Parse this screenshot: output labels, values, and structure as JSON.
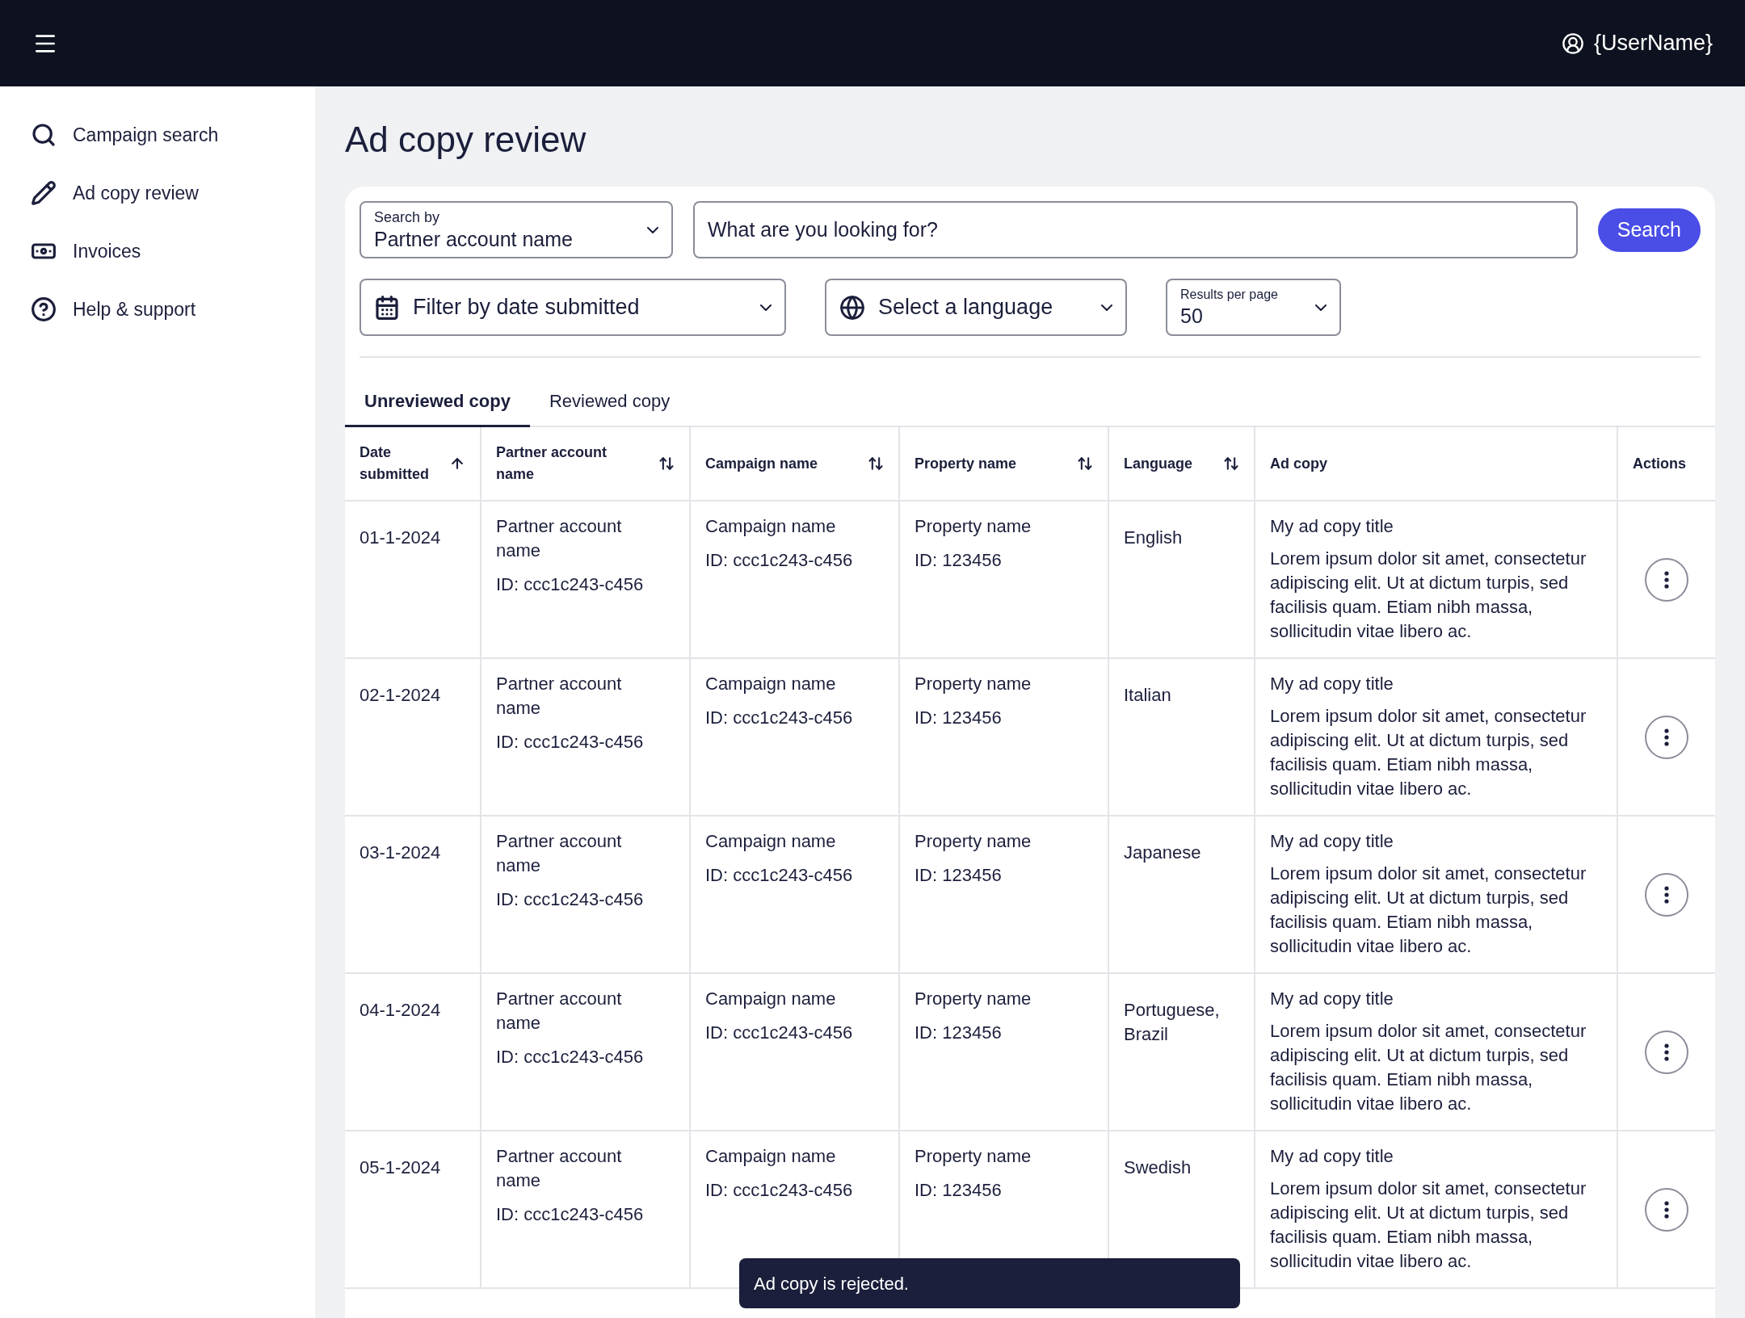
{
  "top_bar": {
    "user_name": "{UserName}"
  },
  "sidebar": {
    "items": [
      {
        "label": "Campaign search",
        "selected": false
      },
      {
        "label": "Ad copy review",
        "selected": false
      },
      {
        "label": "Invoices",
        "selected": false
      },
      {
        "label": "Help & support",
        "selected": false
      }
    ]
  },
  "page_title": "Ad copy review",
  "search": {
    "search_by_label": "Search by",
    "search_by_value": "Partner account name",
    "placeholder": "What are you looking for?",
    "button": "Search"
  },
  "filters": {
    "date_placeholder": "Filter by date submitted",
    "language_placeholder": "Select a language",
    "results_label": "Results per page",
    "results_value": "50"
  },
  "tabs": [
    {
      "label": "Unreviewed copy",
      "selected": true
    },
    {
      "label": "Reviewed copy",
      "selected": false
    }
  ],
  "table": {
    "columns": [
      {
        "label": "Date submitted",
        "kind": "sorted"
      },
      {
        "label": "Partner account name",
        "kind": "sortable"
      },
      {
        "label": "Campaign name",
        "kind": "sortable"
      },
      {
        "label": "Property name",
        "kind": "sortable"
      },
      {
        "label": "Language",
        "kind": "sortable"
      },
      {
        "label": "Ad copy",
        "kind": "plain"
      },
      {
        "label": "Actions",
        "kind": "plain"
      }
    ],
    "rows": [
      {
        "date": "01-1-2024",
        "partner": "Partner account name",
        "partner_id": "ID: ccc1c243-c456",
        "campaign": "Campaign name",
        "campaign_id": "ID: ccc1c243-c456",
        "property": "Property name",
        "property_id": "ID: 123456",
        "language": "English",
        "ad_title": "My ad copy title",
        "ad_body": "Lorem ipsum dolor sit amet, consectetur adipiscing elit. Ut at dictum turpis, sed facilisis quam. Etiam nibh massa, sollicitudin vitae libero ac."
      },
      {
        "date": "02-1-2024",
        "partner": "Partner account name",
        "partner_id": "ID: ccc1c243-c456",
        "campaign": "Campaign name",
        "campaign_id": "ID: ccc1c243-c456",
        "property": "Property name",
        "property_id": "ID: 123456",
        "language": "Italian",
        "ad_title": "My ad copy title",
        "ad_body": "Lorem ipsum dolor sit amet, consectetur adipiscing elit. Ut at dictum turpis, sed facilisis quam. Etiam nibh massa, sollicitudin vitae libero ac."
      },
      {
        "date": "03-1-2024",
        "partner": "Partner account name",
        "partner_id": "ID: ccc1c243-c456",
        "campaign": "Campaign name",
        "campaign_id": "ID: ccc1c243-c456",
        "property": "Property name",
        "property_id": "ID: 123456",
        "language": "Japanese",
        "ad_title": "My ad copy title",
        "ad_body": "Lorem ipsum dolor sit amet, consectetur adipiscing elit. Ut at dictum turpis, sed facilisis quam. Etiam nibh massa, sollicitudin vitae libero ac."
      },
      {
        "date": "04-1-2024",
        "partner": "Partner account name",
        "partner_id": "ID: ccc1c243-c456",
        "campaign": "Campaign name",
        "campaign_id": "ID: ccc1c243-c456",
        "property": "Property name",
        "property_id": "ID: 123456",
        "language": "Portuguese, Brazil",
        "ad_title": "My ad copy title",
        "ad_body": "Lorem ipsum dolor sit amet, consectetur adipiscing elit. Ut at dictum turpis, sed facilisis quam. Etiam nibh massa, sollicitudin vitae libero ac."
      },
      {
        "date": "05-1-2024",
        "partner": "Partner account name",
        "partner_id": "ID: ccc1c243-c456",
        "campaign": "Campaign name",
        "campaign_id": "ID: ccc1c243-c456",
        "property": "Property name",
        "property_id": "ID: 123456",
        "language": "Swedish",
        "ad_title": "My ad copy title",
        "ad_body": "Lorem ipsum dolor sit amet, consectetur adipiscing elit. Ut at dictum turpis, sed facilisis quam. Etiam nibh massa, sollicitudin vitae libero ac."
      }
    ]
  },
  "toast": {
    "message": "Ad copy is rejected."
  }
}
